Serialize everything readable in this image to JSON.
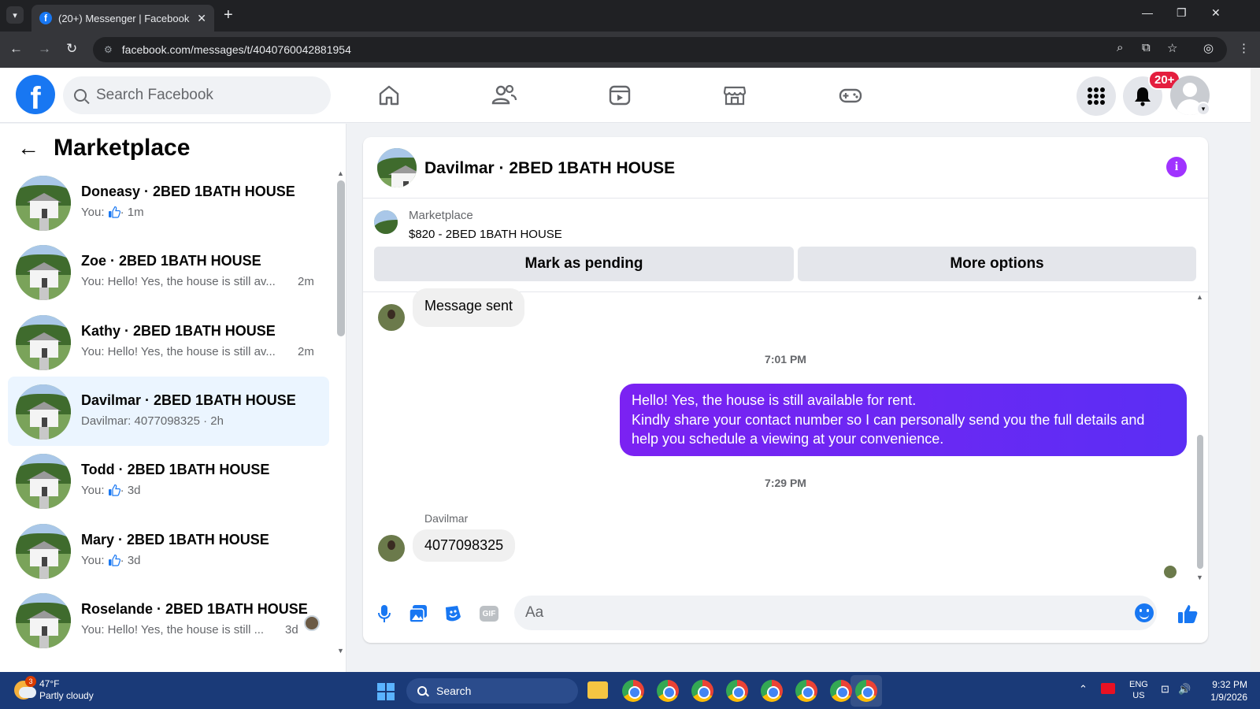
{
  "browser": {
    "tab_title": "(20+) Messenger | Facebook",
    "url": "facebook.com/messages/t/4040760042881954"
  },
  "fb_nav": {
    "search_placeholder": "Search Facebook",
    "notification_badge": "20+"
  },
  "sidebar": {
    "title": "Marketplace",
    "conversations": [
      {
        "name": "Doneasy · 2BED 1BATH HOUSE",
        "preview": "You:",
        "time": "· 1m",
        "thumb": true,
        "active": false
      },
      {
        "name": "Zoe · 2BED 1BATH HOUSE",
        "preview": "You: Hello! Yes, the house is still av...",
        "time": "2m",
        "thumb": false,
        "active": false
      },
      {
        "name": "Kathy · 2BED 1BATH HOUSE",
        "preview": "You: Hello! Yes, the house is still av...",
        "time": "2m",
        "thumb": false,
        "active": false
      },
      {
        "name": "Davilmar · 2BED 1BATH HOUSE",
        "preview": "Davilmar: 4077098325 · 2h",
        "time": "",
        "thumb": false,
        "active": true
      },
      {
        "name": "Todd · 2BED 1BATH HOUSE",
        "preview": "You:",
        "time": "· 3d",
        "thumb": true,
        "active": false
      },
      {
        "name": "Mary · 2BED 1BATH HOUSE",
        "preview": "You:",
        "time": "· 3d",
        "thumb": true,
        "active": false
      },
      {
        "name": "Roselande · 2BED 1BATH HOUSE",
        "preview": "You: Hello! Yes, the house is still ...",
        "time": "3d",
        "thumb": false,
        "active": false
      }
    ]
  },
  "chat": {
    "title": "Davilmar · 2BED 1BATH HOUSE",
    "marketplace_label": "Marketplace",
    "listing": "$820 - 2BED 1BATH HOUSE",
    "mark_pending_label": "Mark as pending",
    "more_options_label": "More options",
    "messages": {
      "first_in": "Message sent",
      "stamp1": "7:01 PM",
      "out_line1": "Hello! Yes, the house is still available for rent.",
      "out_line2": "Kindly share your contact number so I can personally send you the full details and help you schedule a viewing at your convenience.",
      "stamp2": "7:29 PM",
      "sender": "Davilmar",
      "reply": "4077098325"
    },
    "composer_placeholder": "Aa"
  },
  "taskbar": {
    "temp": "47°F",
    "weather": "Partly cloudy",
    "weather_badge": "3",
    "search_label": "Search",
    "lang1": "ENG",
    "lang2": "US",
    "time": "9:32 PM",
    "date": "1/9/2026"
  },
  "colors": {
    "brand": "#1877f2",
    "active_conv": "#ebf5ff",
    "outgoing_bubble": "#7b22f2",
    "info_icon": "#a033ff"
  }
}
